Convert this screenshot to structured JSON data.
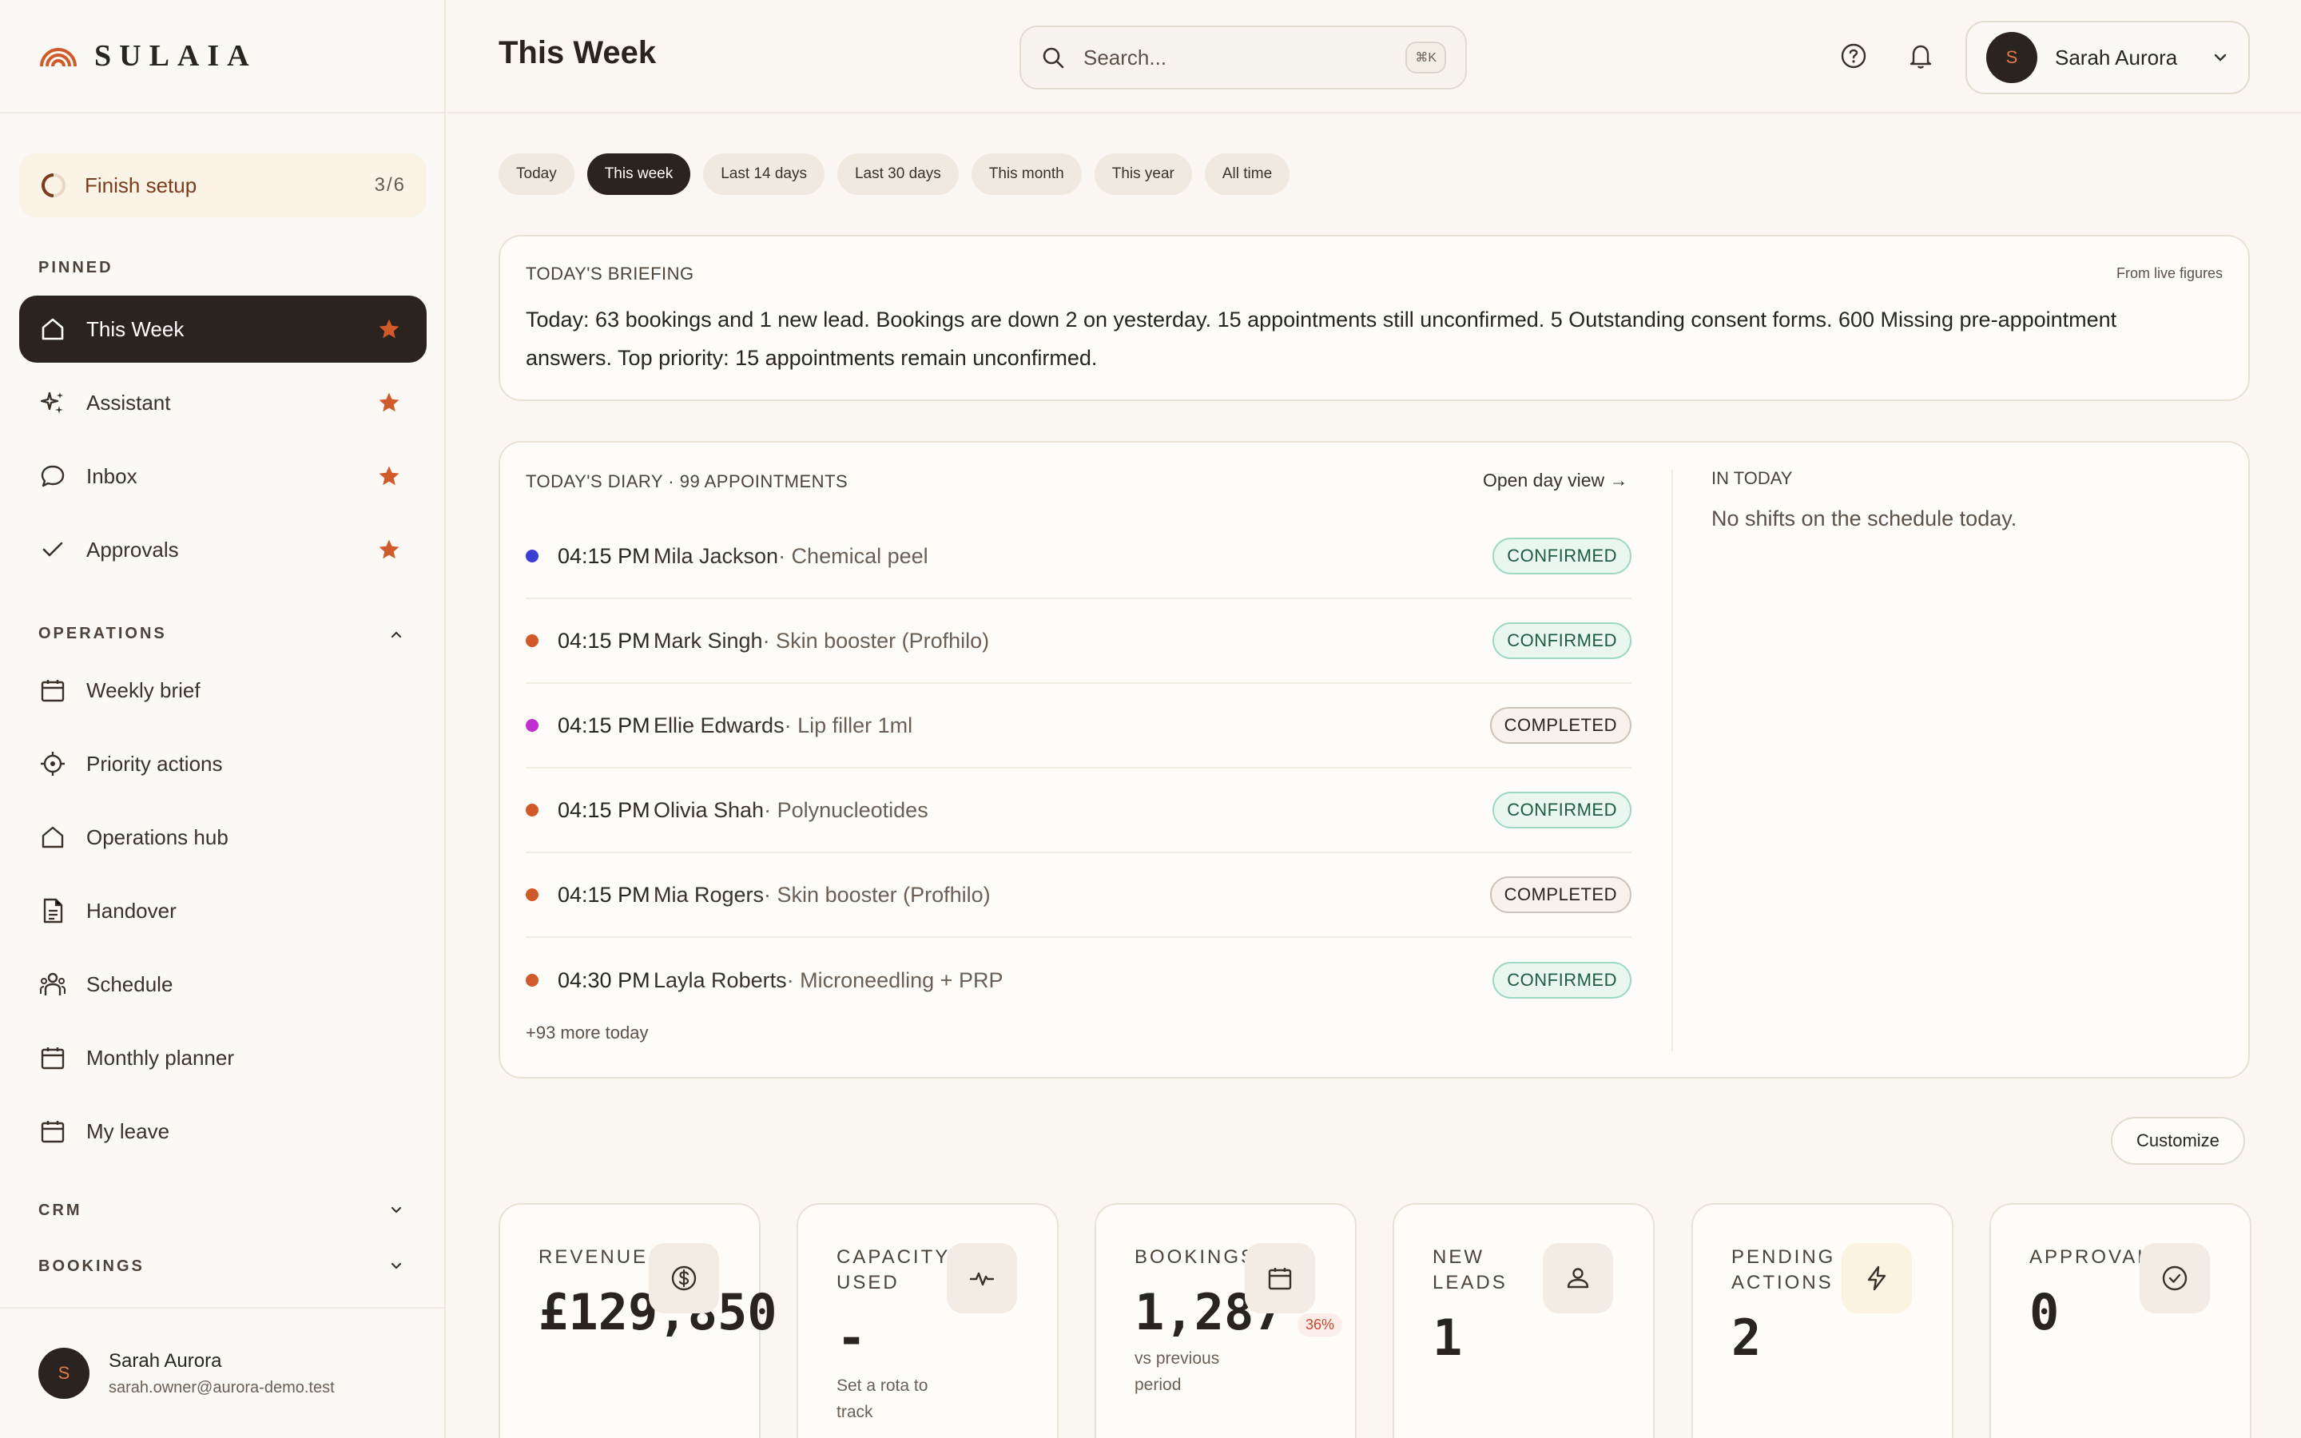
{
  "brand": {
    "name": "SULAIA"
  },
  "setup": {
    "label": "Finish setup",
    "count": "3/6"
  },
  "sidebar": {
    "pinned_label": "PINNED",
    "pinned": [
      {
        "label": "This Week",
        "icon": "home-icon"
      },
      {
        "label": "Assistant",
        "icon": "sparkles-icon"
      },
      {
        "label": "Inbox",
        "icon": "chat-bubble-icon"
      },
      {
        "label": "Approvals",
        "icon": "check-icon"
      }
    ],
    "operations_label": "OPERATIONS",
    "operations": [
      {
        "label": "Weekly brief",
        "icon": "calendar-icon"
      },
      {
        "label": "Priority actions",
        "icon": "target-icon"
      },
      {
        "label": "Operations hub",
        "icon": "home-icon"
      },
      {
        "label": "Handover",
        "icon": "document-icon"
      },
      {
        "label": "Schedule",
        "icon": "people-icon"
      },
      {
        "label": "Monthly planner",
        "icon": "calendar-icon"
      },
      {
        "label": "My leave",
        "icon": "calendar-icon"
      }
    ],
    "crm_label": "CRM",
    "bookings_label": "BOOKINGS",
    "user": {
      "initial": "S",
      "name": "Sarah Aurora",
      "email": "sarah.owner@aurora-demo.test"
    }
  },
  "header": {
    "title": "This Week",
    "search_placeholder": "Search...",
    "search_shortcut": "⌘K",
    "user_initial": "S",
    "user_name": "Sarah Aurora"
  },
  "filters": [
    "Today",
    "This week",
    "Last 14 days",
    "Last 30 days",
    "This month",
    "This year",
    "All time"
  ],
  "briefing": {
    "caption": "TODAY'S BRIEFING",
    "note": "From live figures",
    "text": "Today: 63 bookings and 1 new lead. Bookings are down 2 on yesterday. 15 appointments still unconfirmed. 5 Outstanding consent forms. 600 Missing pre-appointment answers. Top priority: 15 appointments remain unconfirmed."
  },
  "diary": {
    "caption": "TODAY'S DIARY · 99 APPOINTMENTS",
    "open_day_view": "Open day view →",
    "in_today_caption": "IN TODAY",
    "in_today_text": "No shifts on the schedule today.",
    "more_today": "+93 more today",
    "rows": [
      {
        "time": "04:15 PM",
        "name": "Mila Jackson",
        "service": " · Chemical peel",
        "status": "CONFIRMED",
        "dot_color": "#3b3fd6"
      },
      {
        "time": "04:15 PM",
        "name": "Mark Singh",
        "service": " · Skin booster (Profhilo)",
        "status": "CONFIRMED",
        "dot_color": "#d05a2a"
      },
      {
        "time": "04:15 PM",
        "name": "Ellie Edwards",
        "service": " · Lip filler 1ml",
        "status": "COMPLETED",
        "dot_color": "#c030d0"
      },
      {
        "time": "04:15 PM",
        "name": "Olivia Shah",
        "service": " · Polynucleotides",
        "status": "CONFIRMED",
        "dot_color": "#d05a2a"
      },
      {
        "time": "04:15 PM",
        "name": "Mia Rogers",
        "service": " · Skin booster (Profhilo)",
        "status": "COMPLETED",
        "dot_color": "#d05a2a"
      },
      {
        "time": "04:30 PM",
        "name": "Layla Roberts",
        "service": " · Microneedling + PRP",
        "status": "CONFIRMED",
        "dot_color": "#d05a2a"
      }
    ]
  },
  "customize_label": "Customize",
  "kpis": [
    {
      "label": "REVENUE",
      "value": "£129,850",
      "sub": "",
      "badge": "",
      "icon": "dollar-icon"
    },
    {
      "label": "CAPACITY USED",
      "value": "-",
      "sub": "Set a rota to track",
      "badge": "",
      "icon": "pulse-icon"
    },
    {
      "label": "BOOKINGS",
      "value": "1,287",
      "sub": "vs previous period",
      "badge": "36%",
      "icon": "calendar-icon"
    },
    {
      "label": "NEW LEADS",
      "value": "1",
      "sub": "",
      "badge": "",
      "icon": "user-icon"
    },
    {
      "label": "PENDING ACTIONS",
      "value": "2",
      "sub": "",
      "badge": "",
      "icon": "bolt-icon"
    },
    {
      "label": "APPROVALS",
      "value": "0",
      "sub": "",
      "badge": "",
      "icon": "check-circle-icon"
    }
  ],
  "colors": {
    "accent": "#d05a2a",
    "dark": "#2b2320",
    "background": "#faf7f2"
  }
}
